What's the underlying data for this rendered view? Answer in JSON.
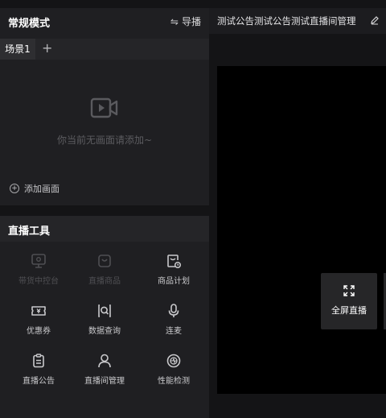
{
  "mode_panel": {
    "title": "常规模式",
    "guide_label": "导播"
  },
  "scenes": {
    "tabs": [
      {
        "label": "场景1"
      }
    ],
    "add_symbol": "+"
  },
  "empty_state": {
    "text": "你当前无画面请添加~",
    "add_view_label": "添加画面"
  },
  "tools": {
    "title": "直播工具",
    "items": [
      {
        "label": "带货中控台",
        "icon": "monitor-icon",
        "enabled": false
      },
      {
        "label": "直播商品",
        "icon": "bag-icon",
        "enabled": false
      },
      {
        "label": "商品计划",
        "icon": "product-plan-icon",
        "enabled": true
      },
      {
        "label": "优惠券",
        "icon": "coupon-icon",
        "enabled": true
      },
      {
        "label": "数据查询",
        "icon": "data-search-icon",
        "enabled": true
      },
      {
        "label": "连麦",
        "icon": "microphone-icon",
        "enabled": true
      },
      {
        "label": "直播公告",
        "icon": "clipboard-icon",
        "enabled": true
      },
      {
        "label": "直播间管理",
        "icon": "user-icon",
        "enabled": true
      },
      {
        "label": "性能检测",
        "icon": "performance-icon",
        "enabled": true
      }
    ]
  },
  "header": {
    "notice_title": "测试公告测试公告测试直播间管理"
  },
  "preview": {
    "fullscreen_label": "全屏直播"
  },
  "colors": {
    "panel_bg": "#1f1f22",
    "page_bg": "#141416",
    "disabled": "#4f4f53",
    "enabled": "#c9c9cc"
  }
}
